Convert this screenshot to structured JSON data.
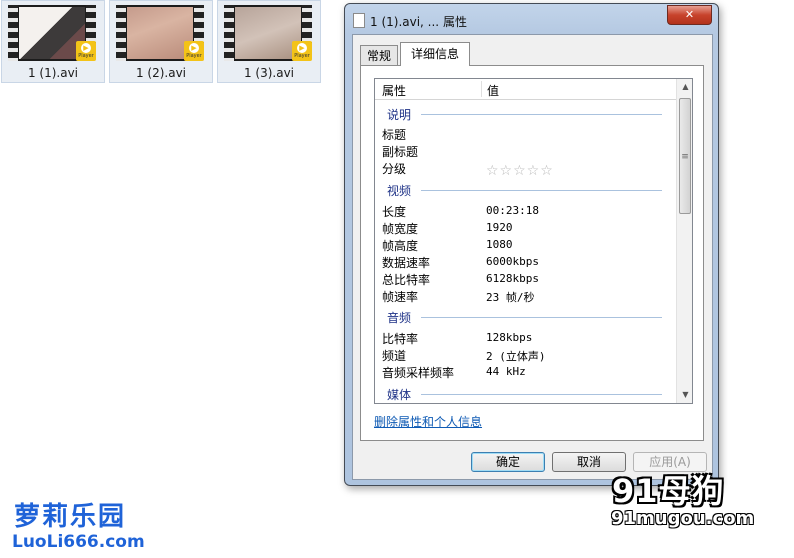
{
  "files": [
    {
      "name": "1 (1).avi",
      "badge": "Player"
    },
    {
      "name": "1 (2).avi",
      "badge": "Player"
    },
    {
      "name": "1 (3).avi",
      "badge": "Player"
    }
  ],
  "dialog": {
    "title": "1 (1).avi, ... 属性",
    "close_label": "✕",
    "tabs": [
      "常规",
      "详细信息"
    ],
    "active_tab": "详细信息",
    "list": {
      "col_name": "属性",
      "col_value": "值",
      "groups": [
        {
          "label": "说明",
          "rows": [
            {
              "name": "标题",
              "value": ""
            },
            {
              "name": "副标题",
              "value": ""
            },
            {
              "name": "分级",
              "value": "",
              "stars": "☆☆☆☆☆"
            }
          ]
        },
        {
          "label": "视频",
          "rows": [
            {
              "name": "长度",
              "value": "00:23:18"
            },
            {
              "name": "帧宽度",
              "value": "1920"
            },
            {
              "name": "帧高度",
              "value": "1080"
            },
            {
              "name": "数据速率",
              "value": "6000kbps"
            },
            {
              "name": "总比特率",
              "value": "6128kbps"
            },
            {
              "name": "帧速率",
              "value": "23 帧/秒"
            }
          ]
        },
        {
          "label": "音频",
          "rows": [
            {
              "name": "比特率",
              "value": "128kbps"
            },
            {
              "name": "频道",
              "value": "2 (立体声)"
            },
            {
              "name": "音频采样频率",
              "value": "44 kHz"
            }
          ]
        },
        {
          "label": "媒体",
          "rows": []
        }
      ]
    },
    "remove_link": "删除属性和个人信息",
    "buttons": {
      "ok": "确定",
      "cancel": "取消",
      "apply": "应用(A)"
    }
  },
  "watermarks": {
    "left_cn": "萝莉乐园",
    "left_url": "LuoLi666.com",
    "right_logo": "91母狗",
    "right_url": "91mugou.com"
  }
}
